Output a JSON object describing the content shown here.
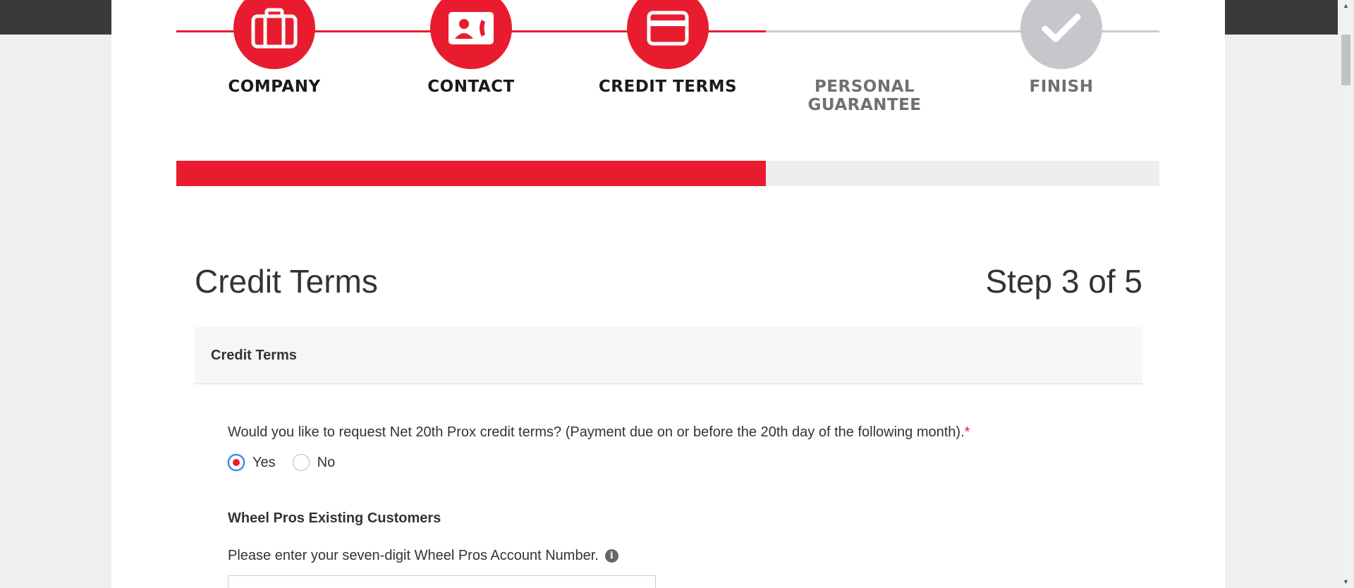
{
  "stepper": {
    "steps": [
      {
        "label": "COMPANY",
        "icon": "briefcase-icon",
        "state": "done"
      },
      {
        "label": "CONTACT",
        "icon": "contact-card-icon",
        "state": "done"
      },
      {
        "label": "CREDIT TERMS",
        "icon": "credit-card-icon",
        "state": "current"
      },
      {
        "label": "PERSONAL GUARANTEE",
        "icon": "",
        "state": "pending"
      },
      {
        "label": "FINISH",
        "icon": "checkmark-icon",
        "state": "pending"
      }
    ],
    "progress_fraction": 0.6
  },
  "header": {
    "title": "Credit Terms",
    "step_counter": "Step 3 of 5"
  },
  "panel": {
    "title": "Credit Terms"
  },
  "form": {
    "question": "Would you like to request Net 20th Prox credit terms? (Payment due on or before the 20th day of the following month).",
    "required_marker": "*",
    "options": [
      {
        "label": "Yes",
        "checked": true
      },
      {
        "label": "No",
        "checked": false
      }
    ],
    "existing_customers_heading": "Wheel Pros Existing Customers",
    "account_number_label": "Please enter your seven-digit Wheel Pros Account Number.",
    "account_number_value": ""
  },
  "colors": {
    "accent": "#e81c2e",
    "pending": "#c5c7ca",
    "focus": "#2a7de1"
  }
}
